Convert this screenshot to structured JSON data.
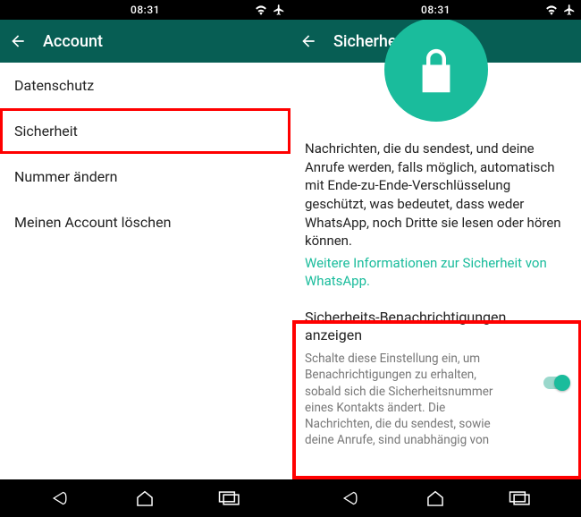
{
  "status": {
    "time": "08:31"
  },
  "left": {
    "title": "Account",
    "items": [
      {
        "label": "Datenschutz"
      },
      {
        "label": "Sicherheit",
        "highlighted": true
      },
      {
        "label": "Nummer ändern"
      },
      {
        "label": "Meinen Account löschen"
      }
    ]
  },
  "right": {
    "title": "Sicherheit",
    "paragraph": "Nachrichten, die du sendest, und deine Anrufe werden, falls möglich, automatisch mit Ende-zu-Ende-Verschlüsselung geschützt, was bedeutet, dass weder WhatsApp, noch Dritte sie lesen oder hören können.",
    "link": "Weitere Informationen zur Sicherheit von WhatsApp.",
    "setting_title": "Sicherheits-Benachrichtigungen anzeigen",
    "setting_desc": "Schalte diese Einstellung ein, um Benachrichtigungen zu erhalten, sobald sich die Sicherheitsnummer eines Kontakts ändert. Die Nachrichten, die du sendest, sowie deine Anrufe, sind unabhängig von",
    "toggle_on": true
  }
}
